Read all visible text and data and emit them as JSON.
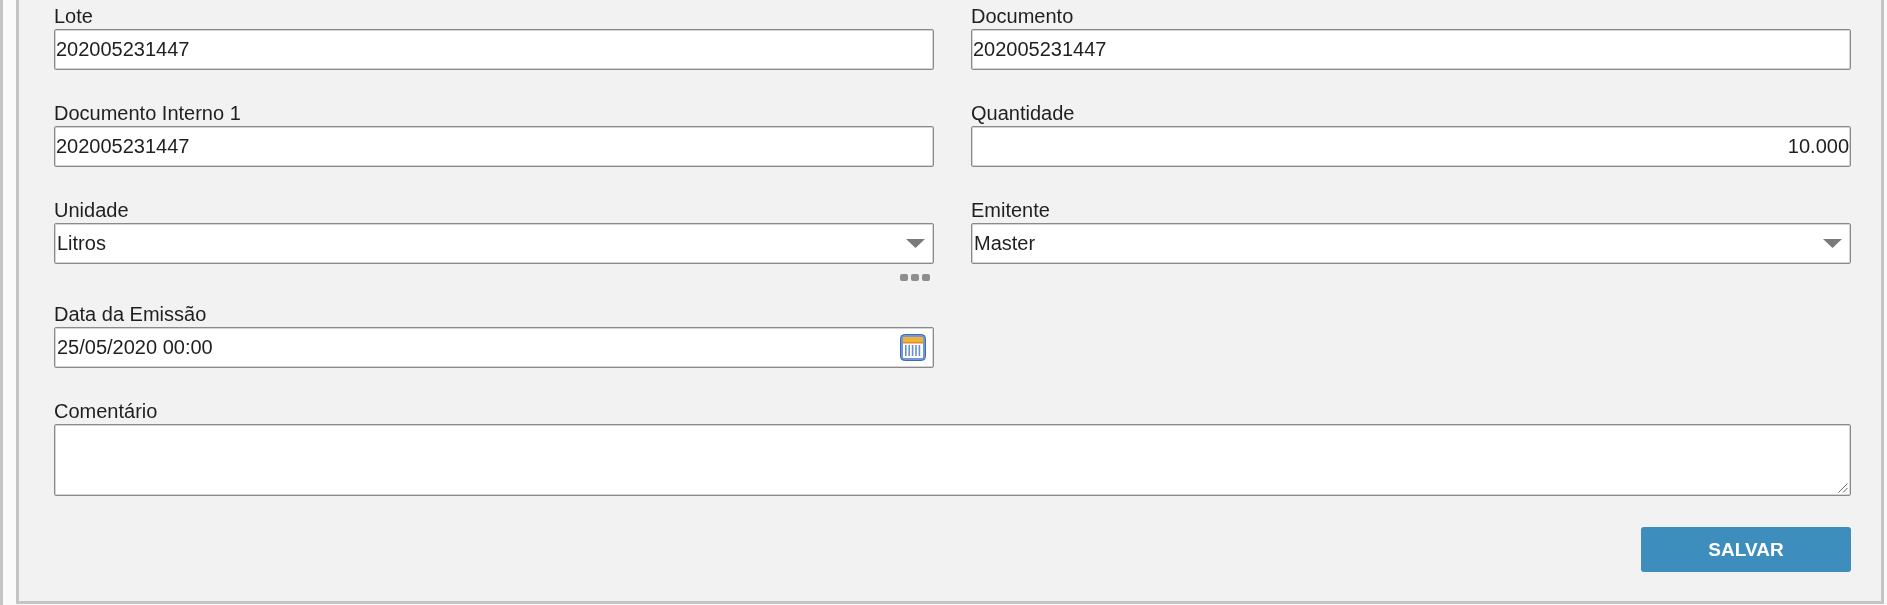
{
  "form": {
    "fields": [
      {
        "kind": "text",
        "label": "Lote",
        "value": "202005231447"
      },
      {
        "kind": "text",
        "label": "Documento",
        "value": "202005231447"
      },
      {
        "kind": "text",
        "label": "Documento Interno 1",
        "value": "202005231447"
      },
      {
        "kind": "number",
        "label": "Quantidade",
        "value": "10.000"
      },
      {
        "kind": "select",
        "label": "Unidade",
        "value": "Litros",
        "more_button": true
      },
      {
        "kind": "select",
        "label": "Emitente",
        "value": "Master",
        "more_button": false
      },
      {
        "kind": "date",
        "label": "Data da Emissão",
        "value": "25/05/2020 00:00"
      },
      {
        "kind": "textarea",
        "label": "Comentário"
      }
    ]
  },
  "buttons": [
    {
      "label": "SALVAR"
    }
  ]
}
